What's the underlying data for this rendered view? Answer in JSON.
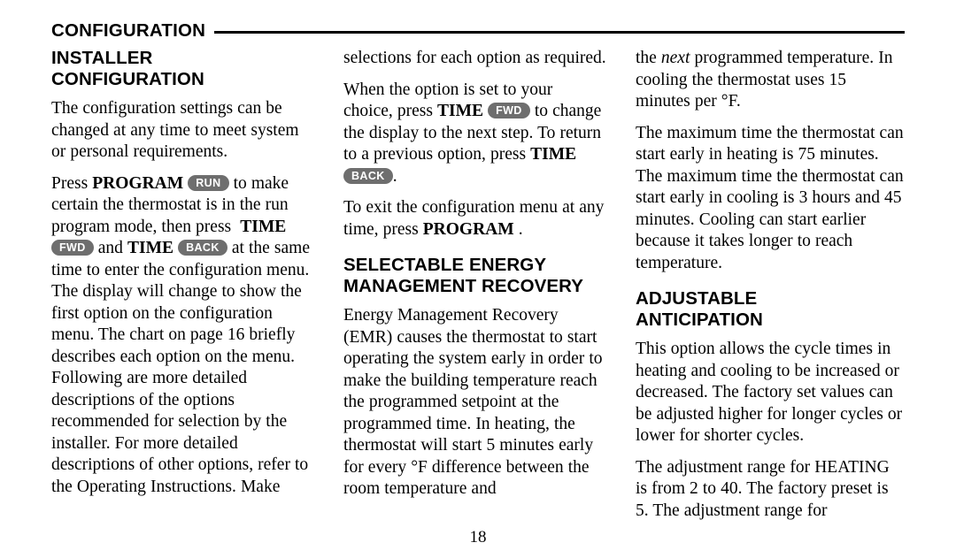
{
  "running_head": {
    "title": "CONFIGURATION"
  },
  "folio": {
    "page_number": "18"
  },
  "colors": {
    "key_pill_background": "#6e6e6e",
    "key_pill_text": "#ffffff",
    "rule": "#000000",
    "text": "#000000",
    "page_background": "#ffffff"
  },
  "column_1": {
    "heading_line_1": "INSTALLER",
    "heading_line_2": "CONFIGURATION",
    "paragraph_1": "The configuration settings can be changed at any time to meet system or personal requirements.",
    "paragraph_2": {
      "part_1": "Press ",
      "bold_1": "PROGRAM",
      "key_1": "RUN",
      "part_2": " to make certain the thermostat is in the run program mode, then press ",
      "bold_2": "TIME",
      "key_2": "FWD",
      "part_3": " and ",
      "bold_3": "TIME",
      "key_3": "BACK",
      "part_4": " at the same time to enter the configuration menu. The display will change to show the first option on the configuration menu. The chart on page 16 briefly describes each option on the menu. Following are more detailed descriptions of the options recommended for selection by the installer. For more detailed descriptions of other options, refer to the Operating Instructions. Make"
    }
  },
  "column_2": {
    "paragraph_1": "selections for each option as required.",
    "paragraph_2": {
      "part_1": "When the option is set to your choice, press ",
      "bold_1": "TIME",
      "key_1": "FWD",
      "part_2": " to change the display to the next step. To return to a previous option, press ",
      "bold_2": "TIME",
      "key_2": "BACK",
      "part_3": "."
    },
    "paragraph_3": {
      "part_1": "To exit the configuration menu at any time, press ",
      "bold_1": "PROGRAM",
      "part_2": " ."
    },
    "heading_line_1": "SELECTABLE ENERGY",
    "heading_line_2": "MANAGEMENT RECOVERY",
    "paragraph_4": "Energy Management Recovery (EMR) causes the thermostat to start operating the system early in order to make the building temperature reach the programmed setpoint at the programmed time. In heating, the thermostat will start 5 minutes early for every °F difference between the room temperature and"
  },
  "column_3": {
    "paragraph_1": {
      "part_1": "the ",
      "italic_1": "next",
      "part_2": " programmed temperature. In cooling the thermostat uses 15 minutes per °F."
    },
    "paragraph_2": "The maximum time the thermostat can start early in heating is 75 minutes. The maximum time the thermostat can start early in cooling is 3 hours and 45 minutes. Cooling can start earlier because it takes longer to reach temperature.",
    "heading_line_1": "ADJUSTABLE",
    "heading_line_2": "ANTICIPATION",
    "paragraph_3": "This option allows the cycle times in heating and cooling to be increased or decreased. The factory set values can be adjusted higher for longer cycles or lower for shorter cycles.",
    "paragraph_4": "The adjustment range for HEATING is from 2 to 40. The factory preset is 5. The adjustment range for"
  }
}
